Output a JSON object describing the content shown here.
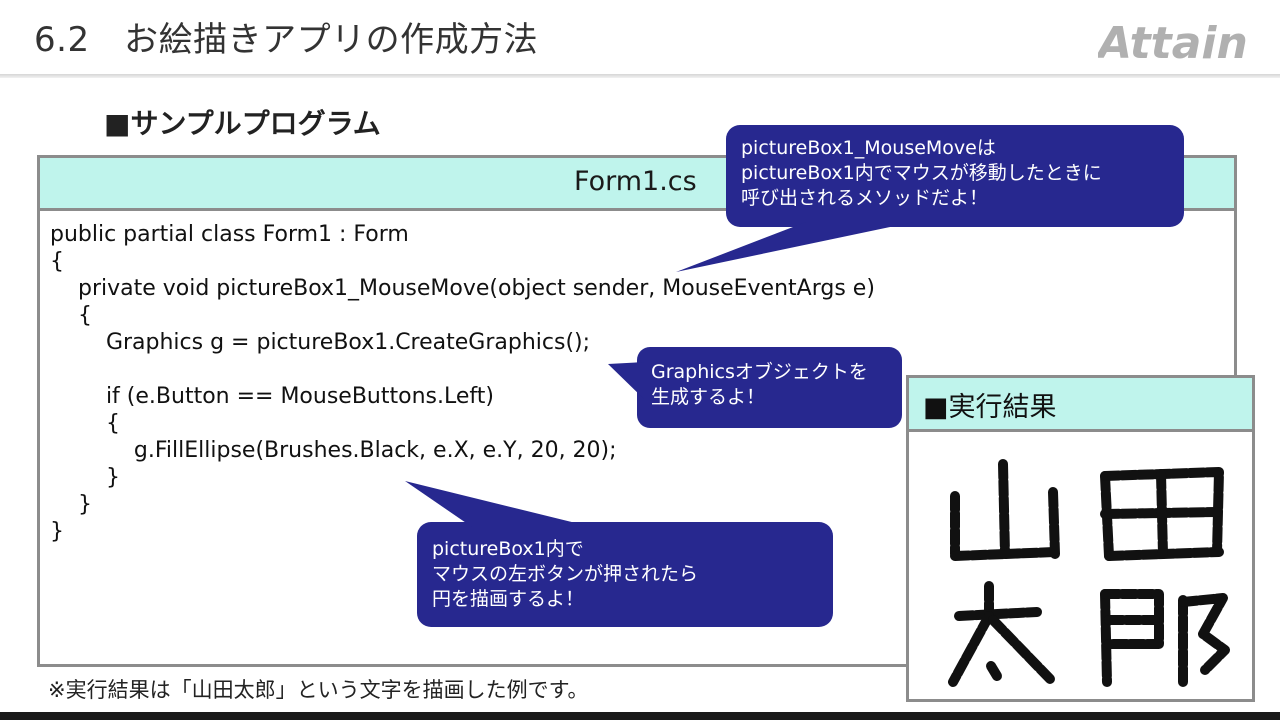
{
  "header": {
    "title": "6.2　お絵描きアプリの作成方法",
    "logo_text": "Attain"
  },
  "section_heading": "■サンプルプログラム",
  "code_panel": {
    "filename": "Form1.cs",
    "lines": [
      "public partial class Form1 : Form",
      "{",
      "    private void pictureBox1_MouseMove(object sender, MouseEventArgs e)",
      "    {",
      "        Graphics g = pictureBox1.CreateGraphics();",
      "",
      "        if (e.Button == MouseButtons.Left)",
      "        {",
      "            g.FillEllipse(Brushes.Black, e.X, e.Y, 20, 20);",
      "        }",
      "    }",
      "}"
    ]
  },
  "callouts": {
    "mousemove": "pictureBox1_MouseMoveは\npictureBox1内でマウスが移動したときに\n呼び出されるメソッドだよ！",
    "graphics": "Graphicsオブジェクトを\n生成するよ！",
    "fill": "pictureBox1内で\nマウスの左ボタンが押されたら\n円を描画するよ！"
  },
  "result_panel": {
    "title": "■実行結果",
    "drawn_name": "山田太郎"
  },
  "footnote": "※実行結果は「山田太郎」という文字を描画した例です。",
  "colors": {
    "panel_header": "#bff4ec",
    "callout_fill": "#27288f",
    "border": "#8c8c8c",
    "logo": "#b0b0b0"
  }
}
